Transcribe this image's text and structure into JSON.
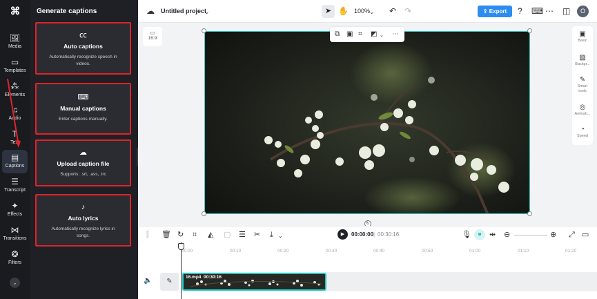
{
  "rail": {
    "items": [
      {
        "label": "Media",
        "icon": "media-icon",
        "glyph": "🖼"
      },
      {
        "label": "Templates",
        "icon": "templates-icon",
        "glyph": "▭"
      },
      {
        "label": "Elements",
        "icon": "elements-icon",
        "glyph": "⁂"
      },
      {
        "label": "Audio",
        "icon": "audio-icon",
        "glyph": "♫"
      },
      {
        "label": "Text",
        "icon": "text-icon",
        "glyph": "T"
      },
      {
        "label": "Captions",
        "icon": "captions-icon",
        "glyph": "▤"
      },
      {
        "label": "Transcript",
        "icon": "transcript-icon",
        "glyph": "☰"
      },
      {
        "label": "Effects",
        "icon": "effects-icon",
        "glyph": "✦"
      },
      {
        "label": "Transitions",
        "icon": "transitions-icon",
        "glyph": "⋈"
      },
      {
        "label": "Filters",
        "icon": "filters-icon",
        "glyph": "❂"
      }
    ]
  },
  "panel": {
    "title": "Generate captions",
    "cards": [
      {
        "title": "Auto captions",
        "desc": "Automatically recognize speech in videos.",
        "icon": "cc-icon",
        "glyph": "㏄"
      },
      {
        "title": "Manual captions",
        "desc": "Enter captions manually.",
        "icon": "keyboard-icon",
        "glyph": "⌨"
      },
      {
        "title": "Upload caption file",
        "desc": "Supports: .srt, .ass, .lrc",
        "icon": "upload-cloud-icon",
        "glyph": "☁"
      },
      {
        "title": "Auto lyrics",
        "desc": "Automatically recognize lyrics in songs.",
        "icon": "lyrics-icon",
        "glyph": "♪"
      }
    ]
  },
  "topbar": {
    "project_title": "Untitled project",
    "zoom": "100%",
    "export_label": "Export",
    "avatar_initial": "O"
  },
  "canvas": {
    "ratio_label": "16:9"
  },
  "right_tools": [
    {
      "label": "Basic",
      "icon": "basic-icon",
      "glyph": "▣"
    },
    {
      "label": "Backgr...",
      "icon": "background-icon",
      "glyph": "▨"
    },
    {
      "label": "Smart tools",
      "icon": "smart-tools-icon",
      "glyph": "✎"
    },
    {
      "label": "Animati...",
      "icon": "animation-icon",
      "glyph": "◎"
    },
    {
      "label": "Speed",
      "icon": "speed-icon",
      "glyph": "◔"
    }
  ],
  "timeline": {
    "current_time": "00:00:00",
    "separator": "|",
    "total_time": "00:30:16",
    "ruler": [
      "00:00",
      "00:10",
      "00:20",
      "00:30",
      "00:40",
      "00:50",
      "01:00",
      "01:10",
      "01:20"
    ],
    "clip_name": "16.mp4",
    "clip_duration": "00:30:16"
  },
  "colors": {
    "accent": "#2d8cf0",
    "selection": "#1ec8c0",
    "highlight_border": "#e0232a"
  }
}
